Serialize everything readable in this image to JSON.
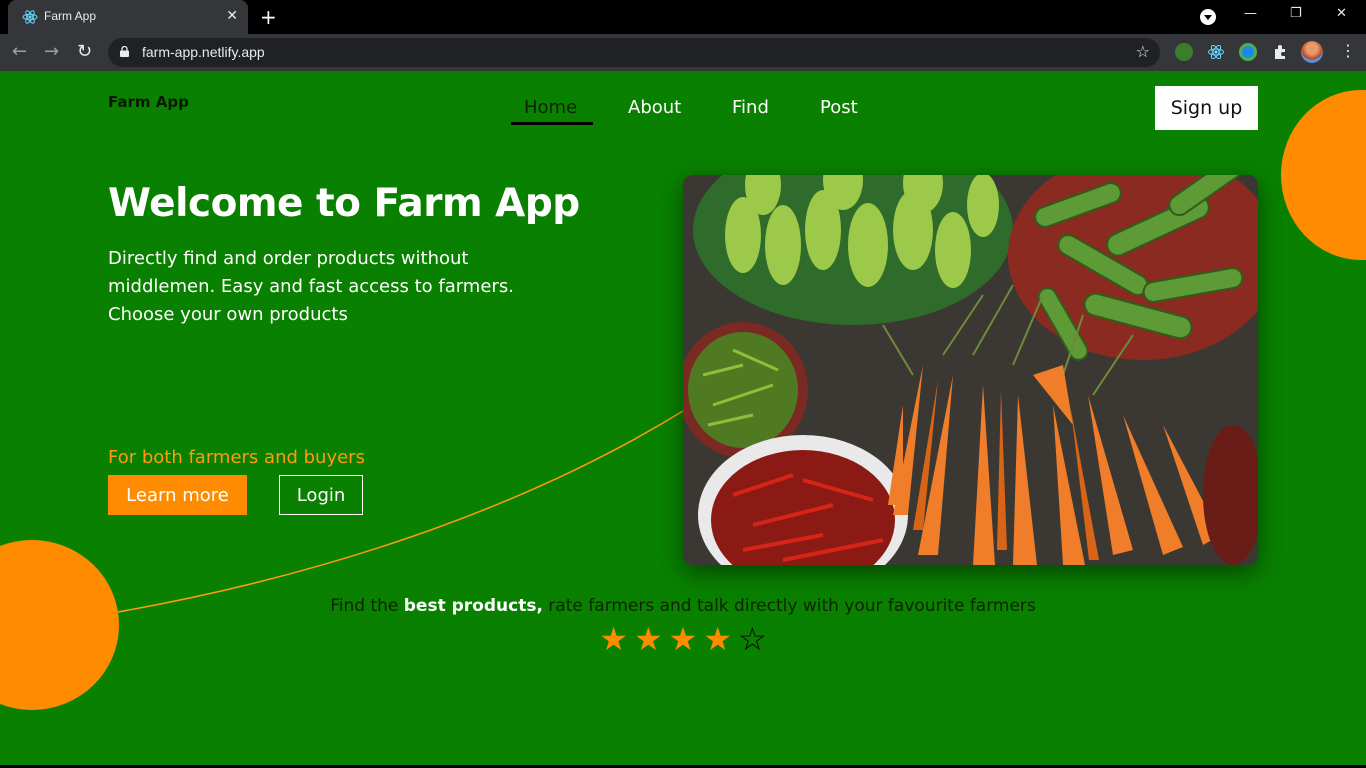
{
  "browser": {
    "tab_title": "Farm App",
    "tab_close": "✕",
    "new_tab": "+",
    "url": "farm-app.netlify.app",
    "minimize": "—",
    "restore": "❐",
    "close": "✕",
    "back": "←",
    "forward": "→",
    "reload": "↻",
    "bookmark_star": "☆"
  },
  "nav": {
    "brand": "Farm App",
    "links": [
      "Home",
      "About",
      "Find",
      "Post"
    ],
    "signup": "Sign up"
  },
  "hero": {
    "title": "Welcome to Farm App",
    "subtitle": "Directly find and order products without middlemen. Easy and fast access to farmers. Choose your own products",
    "for_both": "For both farmers and buyers",
    "learn_more": "Learn more",
    "login": "Login"
  },
  "tagline": {
    "before": "Find the ",
    "highlight": "best products,",
    "after": " rate farmers and talk directly with your favourite farmers"
  },
  "rating": {
    "filled": 4,
    "total": 5,
    "full_glyph": "★",
    "empty_glyph": "☆"
  },
  "colors": {
    "background": "#098000",
    "accent": "#ff8c00",
    "text_dark": "#0a2600"
  }
}
